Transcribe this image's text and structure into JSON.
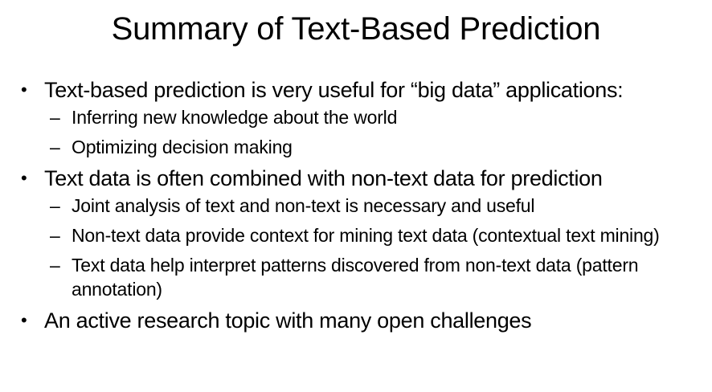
{
  "slide": {
    "title": "Summary of Text-Based Prediction",
    "bullet_marker": "•",
    "sub_marker": "–",
    "bullets": [
      {
        "text": "Text-based prediction is very useful for “big data” applications:",
        "subs": [
          "Inferring new knowledge about the world",
          "Optimizing decision making"
        ]
      },
      {
        "text": "Text data is often combined with non-text data for prediction",
        "subs": [
          "Joint analysis of text and non-text is necessary and useful",
          "Non-text data provide context for mining text data (contextual text mining)",
          "Text data help interpret patterns discovered from non-text data (pattern annotation)"
        ]
      },
      {
        "text": "An active research topic with many open challenges",
        "subs": []
      }
    ]
  }
}
